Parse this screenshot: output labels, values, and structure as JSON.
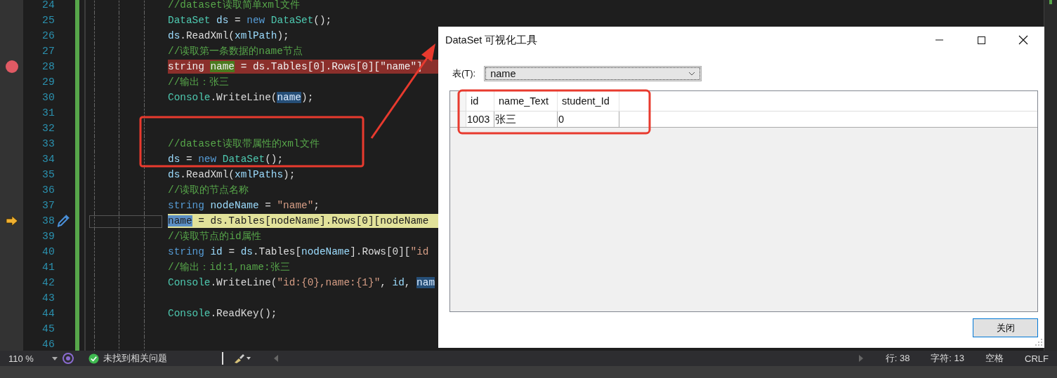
{
  "editor": {
    "lines": [
      {
        "number": "24",
        "breakpoint": false,
        "current": false,
        "quick_action": false,
        "tokens": [
          {
            "text": "//dataset读取简单xml文件",
            "kind": "comment"
          }
        ]
      },
      {
        "number": "25",
        "breakpoint": false,
        "current": false,
        "quick_action": false,
        "tokens": [
          {
            "text": "DataSet",
            "kind": "type"
          },
          {
            "text": " ds",
            "kind": "var"
          },
          {
            "text": " = ",
            "kind": "plain"
          },
          {
            "text": "new",
            "kind": "keyword"
          },
          {
            "text": " DataSet",
            "kind": "type"
          },
          {
            "text": "();",
            "kind": "plain"
          }
        ]
      },
      {
        "number": "26",
        "breakpoint": false,
        "current": false,
        "quick_action": false,
        "tokens": [
          {
            "text": "ds",
            "kind": "var"
          },
          {
            "text": ".ReadXml(",
            "kind": "plain"
          },
          {
            "text": "xmlPath",
            "kind": "var"
          },
          {
            "text": ");",
            "kind": "plain"
          }
        ]
      },
      {
        "number": "27",
        "breakpoint": false,
        "current": false,
        "quick_action": false,
        "tokens": [
          {
            "text": "//读取第一条数据的name节点",
            "kind": "comment"
          }
        ]
      },
      {
        "number": "28",
        "breakpoint": true,
        "current": false,
        "quick_action": false,
        "tokens": [
          {
            "text": "string ",
            "kind": "keyword"
          },
          {
            "text": "name",
            "kind": "reference"
          },
          {
            "text": " = ds.Tables[0].Rows[0][",
            "kind": "plain"
          },
          {
            "text": "\"name\"",
            "kind": "string"
          },
          {
            "text": "]",
            "kind": "plain"
          }
        ]
      },
      {
        "number": "29",
        "breakpoint": false,
        "current": false,
        "quick_action": false,
        "tokens": [
          {
            "text": "//输出：张三",
            "kind": "comment"
          }
        ]
      },
      {
        "number": "30",
        "breakpoint": false,
        "current": false,
        "quick_action": false,
        "tokens": [
          {
            "text": "Console",
            "kind": "type"
          },
          {
            "text": ".WriteLine(",
            "kind": "plain"
          },
          {
            "text": "name",
            "kind": "selected"
          },
          {
            "text": ");",
            "kind": "plain"
          }
        ]
      },
      {
        "number": "31",
        "breakpoint": false,
        "current": false,
        "quick_action": false
      },
      {
        "number": "32",
        "breakpoint": false,
        "current": false,
        "quick_action": false
      },
      {
        "number": "33",
        "breakpoint": false,
        "current": false,
        "quick_action": false,
        "tokens": [
          {
            "text": "//dataset读取带属性的xml文件",
            "kind": "comment"
          }
        ]
      },
      {
        "number": "34",
        "breakpoint": false,
        "current": false,
        "quick_action": false,
        "tokens": [
          {
            "text": "ds",
            "kind": "var"
          },
          {
            "text": " = ",
            "kind": "plain"
          },
          {
            "text": "new",
            "kind": "keyword"
          },
          {
            "text": " DataSet",
            "kind": "type"
          },
          {
            "text": "();",
            "kind": "plain"
          }
        ]
      },
      {
        "number": "35",
        "breakpoint": false,
        "current": false,
        "quick_action": false,
        "tokens": [
          {
            "text": "ds",
            "kind": "var"
          },
          {
            "text": ".ReadXml(",
            "kind": "plain"
          },
          {
            "text": "xmlPaths",
            "kind": "var"
          },
          {
            "text": ");",
            "kind": "plain"
          }
        ]
      },
      {
        "number": "36",
        "breakpoint": false,
        "current": false,
        "quick_action": false,
        "tokens": [
          {
            "text": "//读取的节点名称",
            "kind": "comment"
          }
        ]
      },
      {
        "number": "37",
        "breakpoint": false,
        "current": false,
        "quick_action": false,
        "tokens": [
          {
            "text": "string",
            "kind": "keyword"
          },
          {
            "text": " nodeName",
            "kind": "var"
          },
          {
            "text": " = ",
            "kind": "plain"
          },
          {
            "text": "\"name\"",
            "kind": "string"
          },
          {
            "text": ";",
            "kind": "plain"
          }
        ]
      },
      {
        "number": "38",
        "breakpoint": false,
        "current": true,
        "quick_action": true,
        "tokens": [
          {
            "text": "name",
            "kind": "selected"
          },
          {
            "text": " = ds.Tables[nodeName].Rows[0][nodeName",
            "kind": "plain"
          }
        ]
      },
      {
        "number": "39",
        "breakpoint": false,
        "current": false,
        "quick_action": false,
        "tokens": [
          {
            "text": "//读取节点的id属性",
            "kind": "comment"
          }
        ]
      },
      {
        "number": "40",
        "breakpoint": false,
        "current": false,
        "quick_action": false,
        "tokens": [
          {
            "text": "string",
            "kind": "keyword"
          },
          {
            "text": " id",
            "kind": "var"
          },
          {
            "text": " = ",
            "kind": "plain"
          },
          {
            "text": "ds",
            "kind": "var"
          },
          {
            "text": ".Tables[",
            "kind": "plain"
          },
          {
            "text": "nodeName",
            "kind": "var"
          },
          {
            "text": "].Rows[0][",
            "kind": "plain"
          },
          {
            "text": "\"id",
            "kind": "string"
          }
        ]
      },
      {
        "number": "41",
        "breakpoint": false,
        "current": false,
        "quick_action": false,
        "tokens": [
          {
            "text": "//输出：id:1,name:张三",
            "kind": "comment"
          }
        ]
      },
      {
        "number": "42",
        "breakpoint": false,
        "current": false,
        "quick_action": false,
        "tokens": [
          {
            "text": "Console",
            "kind": "type"
          },
          {
            "text": ".WriteLine(",
            "kind": "plain"
          },
          {
            "text": "\"id:{0},name:{1}\"",
            "kind": "string"
          },
          {
            "text": ", ",
            "kind": "plain"
          },
          {
            "text": "id",
            "kind": "var"
          },
          {
            "text": ", ",
            "kind": "plain"
          },
          {
            "text": "nam",
            "kind": "selected"
          }
        ]
      },
      {
        "number": "43",
        "breakpoint": false,
        "current": false,
        "quick_action": false
      },
      {
        "number": "44",
        "breakpoint": false,
        "current": false,
        "quick_action": false,
        "tokens": [
          {
            "text": "Console",
            "kind": "type"
          },
          {
            "text": ".ReadKey();",
            "kind": "plain"
          }
        ]
      },
      {
        "number": "45",
        "breakpoint": false,
        "current": false,
        "quick_action": false
      },
      {
        "number": "46",
        "breakpoint": false,
        "current": false,
        "quick_action": false
      }
    ]
  },
  "status_bar": {
    "zoom": "110 %",
    "issues": "未找到相关问题",
    "line": "行: 38",
    "char": "字符: 13",
    "whitespace": "空格",
    "line_ending": "CRLF"
  },
  "dialog": {
    "title": "DataSet 可视化工具",
    "table_label": "表(T):",
    "table_select": {
      "value": "name"
    },
    "grid": {
      "columns": [
        "id",
        "name_Text",
        "student_Id"
      ],
      "rows": [
        [
          "1003",
          "张三",
          "0"
        ]
      ]
    },
    "buttons": [
      "关闭"
    ]
  }
}
